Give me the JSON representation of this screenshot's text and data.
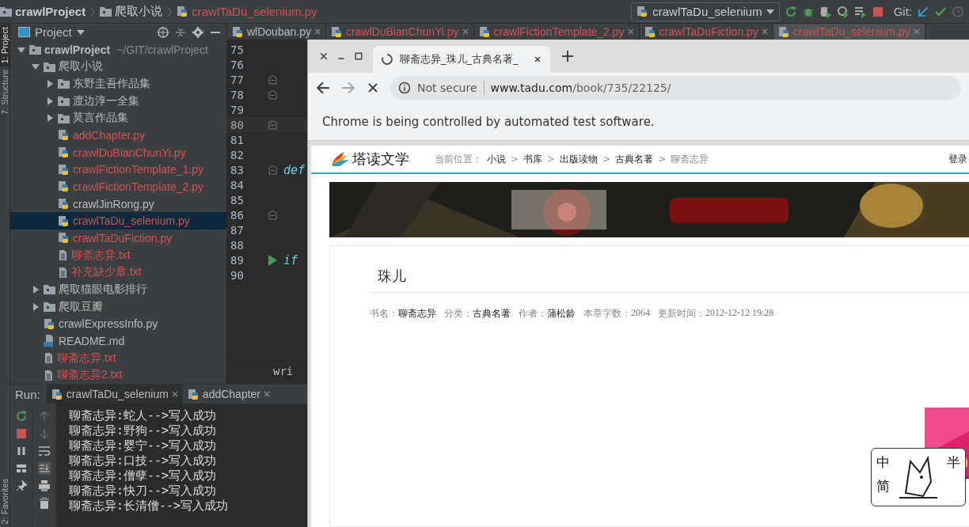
{
  "ide": {
    "breadcrumbs": [
      {
        "kind": "folder",
        "label": "crawlProject",
        "untracked": false
      },
      {
        "kind": "folder",
        "label": "爬取小说",
        "untracked": false
      },
      {
        "kind": "python",
        "label": "crawlTaDu_selenium.py",
        "untracked": true
      }
    ],
    "run_config": "crawlTaDu_selenium",
    "git_label": "Git:",
    "side_tabs": [
      {
        "label": "1: Project",
        "selected": true
      },
      {
        "label": "7: Structure",
        "selected": false
      }
    ],
    "side_tabs_bottom": [
      {
        "label": "2: Favorites",
        "selected": false
      }
    ],
    "project_panel": {
      "title": "Project",
      "tree": [
        {
          "label": "crawlProject",
          "path": "~/GIT/crawlProject",
          "kind": "folder",
          "expanded": true,
          "selected": false,
          "untracked": false,
          "children": [
            {
              "label": "爬取小说",
              "kind": "folder",
              "expanded": true,
              "selected": false,
              "untracked": false,
              "children": [
                {
                  "label": "东野圭吾作品集",
                  "kind": "folder",
                  "expanded": false,
                  "selected": false,
                  "untracked": false
                },
                {
                  "label": "渡边淳一全集",
                  "kind": "folder",
                  "expanded": false,
                  "selected": false,
                  "untracked": false
                },
                {
                  "label": "莫言作品集",
                  "kind": "folder",
                  "expanded": false,
                  "selected": false,
                  "untracked": false
                },
                {
                  "label": "addChapter.py",
                  "kind": "python",
                  "selected": false,
                  "untracked": true
                },
                {
                  "label": "crawlDuBianChunYi.py",
                  "kind": "python",
                  "selected": false,
                  "untracked": true
                },
                {
                  "label": "crawlFictionTemplate_1.py",
                  "kind": "python",
                  "selected": false,
                  "untracked": true
                },
                {
                  "label": "crawlFictionTemplate_2.py",
                  "kind": "python",
                  "selected": false,
                  "untracked": true
                },
                {
                  "label": "crawlJinRong.py",
                  "kind": "python",
                  "selected": false,
                  "untracked": false
                },
                {
                  "label": "crawlTaDu_selenium.py",
                  "kind": "python",
                  "selected": true,
                  "untracked": true
                },
                {
                  "label": "crawlTaDuFiction.py",
                  "kind": "python",
                  "selected": false,
                  "untracked": true
                },
                {
                  "label": "聊斋志异.txt",
                  "kind": "text",
                  "selected": false,
                  "untracked": true
                },
                {
                  "label": "补充缺少章.txt",
                  "kind": "text",
                  "selected": false,
                  "untracked": true
                }
              ]
            },
            {
              "label": "爬取猫眼电影排行",
              "kind": "folder",
              "expanded": false,
              "selected": false,
              "untracked": false
            },
            {
              "label": "爬取豆瓣",
              "kind": "folder",
              "expanded": false,
              "selected": false,
              "untracked": false
            },
            {
              "label": "crawlExpressInfo.py",
              "kind": "python",
              "selected": false,
              "untracked": false
            },
            {
              "label": "README.md",
              "kind": "markdown",
              "selected": false,
              "untracked": false
            },
            {
              "label": "聊斋志异.txt",
              "kind": "text",
              "selected": false,
              "untracked": true
            },
            {
              "label": "聊斋志异2.txt",
              "kind": "text",
              "selected": false,
              "untracked": true
            }
          ]
        }
      ]
    },
    "editor": {
      "tabs": [
        {
          "label": "wlDouban.py",
          "untracked": false,
          "selected": false
        },
        {
          "label": "crawlDuBianChunYi.py",
          "untracked": true,
          "selected": false
        },
        {
          "label": "crawlFictionTemplate_2.py",
          "untracked": true,
          "selected": false
        },
        {
          "label": "crawlTaDuFiction.py",
          "untracked": true,
          "selected": false
        },
        {
          "label": "crawlTaDu_selenium.py",
          "untracked": true,
          "selected": true
        }
      ],
      "lines": [
        {
          "number": "75",
          "current": false,
          "fold": false,
          "run_marker": false
        },
        {
          "number": "76",
          "current": false,
          "fold": false,
          "run_marker": false
        },
        {
          "number": "77",
          "current": false,
          "fold": true,
          "run_marker": false
        },
        {
          "number": "78",
          "current": false,
          "fold": true,
          "run_marker": false
        },
        {
          "number": "79",
          "current": false,
          "fold": false,
          "run_marker": false
        },
        {
          "number": "80",
          "current": true,
          "fold": true,
          "run_marker": false
        },
        {
          "number": "81",
          "current": false,
          "fold": false,
          "run_marker": false
        },
        {
          "number": "82",
          "current": false,
          "fold": false,
          "run_marker": false
        },
        {
          "number": "83",
          "current": false,
          "fold": true,
          "run_marker": false,
          "code": "def"
        },
        {
          "number": "84",
          "current": false,
          "fold": false,
          "run_marker": false
        },
        {
          "number": "85",
          "current": false,
          "fold": false,
          "run_marker": false
        },
        {
          "number": "86",
          "current": false,
          "fold": true,
          "run_marker": false
        },
        {
          "number": "87",
          "current": false,
          "fold": false,
          "run_marker": false
        },
        {
          "number": "88",
          "current": false,
          "fold": false,
          "run_marker": false
        },
        {
          "number": "89",
          "current": false,
          "fold": false,
          "run_marker": true,
          "code": "if"
        },
        {
          "number": "90",
          "current": false,
          "fold": false,
          "run_marker": false
        }
      ],
      "status_text": "wri"
    },
    "run_panel": {
      "label": "Run:",
      "tabs": [
        {
          "label": "crawlTaDu_selenium",
          "selected": true
        },
        {
          "label": "addChapter",
          "selected": false
        }
      ],
      "output": [
        "聊斋志异:蛇人-->写入成功",
        "聊斋志异:野狗-->写入成功",
        "聊斋志异:婴宁-->写入成功",
        "聊斋志异:口技-->写入成功",
        "聊斋志异:僧孽-->写入成功",
        "聊斋志异:快刀-->写入成功",
        "聊斋志异:长清僧-->写入成功"
      ]
    }
  },
  "browser": {
    "tab_title": "聊斋志异_珠儿_古典名著_",
    "security": "Not secure",
    "url_host": "www.tadu.com",
    "url_path": "/book/735/22125/",
    "infobar": "Chrome is being controlled by automated test software.",
    "site": {
      "logo": "塔读文学",
      "location_label": "当前位置：",
      "separator": ">",
      "breadcrumbs": [
        {
          "label": "小说",
          "current": false
        },
        {
          "label": "书库",
          "current": false
        },
        {
          "label": "出版读物",
          "current": false
        },
        {
          "label": "古典名著",
          "current": false
        },
        {
          "label": "聊斋志异",
          "current": true
        }
      ],
      "login": "登录",
      "chapter_title": "珠儿",
      "meta": [
        {
          "label": "书名：",
          "value": "聊斋志异",
          "kind": "text"
        },
        {
          "label": "分类：",
          "value": "古典名著",
          "kind": "text"
        },
        {
          "label": "作者：",
          "value": "蒲松龄",
          "kind": "text"
        },
        {
          "label": "本章字数：",
          "value": "2064",
          "kind": "number"
        },
        {
          "label": "更新时间：",
          "value": "2012-12-12 19:28",
          "kind": "number"
        }
      ]
    }
  },
  "ime": {
    "mode": "中",
    "width": "半",
    "script": "简"
  }
}
